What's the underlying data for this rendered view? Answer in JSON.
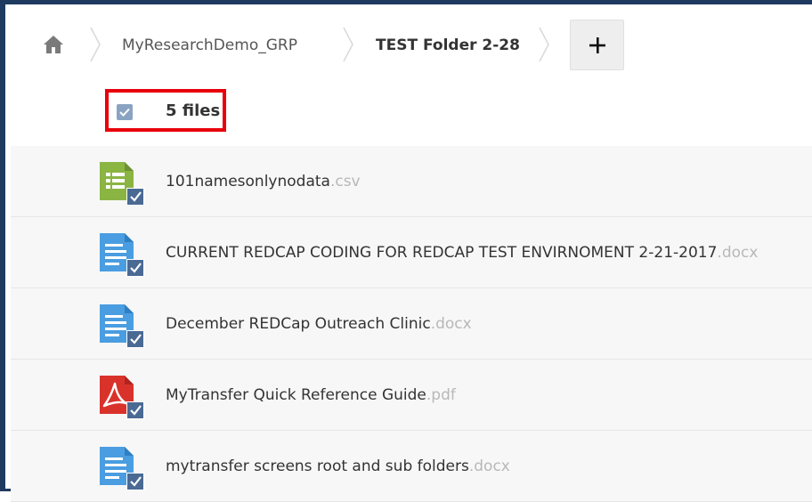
{
  "breadcrumb": {
    "items": [
      {
        "label": "MyResearchDemo_GRP"
      },
      {
        "label": "TEST Folder 2-28"
      }
    ],
    "add_label": "+"
  },
  "selection": {
    "checked": true,
    "label": "5 files",
    "highlight_color": "#e8000b"
  },
  "files": [
    {
      "name": "101namesonlynodata",
      "ext": ".csv",
      "type": "csv",
      "icon": "spreadsheet-icon",
      "icon_color": "#8ab543",
      "selected": true
    },
    {
      "name": "CURRENT REDCAP CODING FOR REDCAP TEST ENVIRNOMENT 2-21-2017",
      "ext": ".docx",
      "type": "docx",
      "icon": "document-icon",
      "icon_color": "#4a9de0",
      "selected": true
    },
    {
      "name": "December REDCap Outreach Clinic",
      "ext": ".docx",
      "type": "docx",
      "icon": "document-icon",
      "icon_color": "#4a9de0",
      "selected": true
    },
    {
      "name": "MyTransfer Quick Reference Guide",
      "ext": ".pdf",
      "type": "pdf",
      "icon": "pdf-icon",
      "icon_color": "#d9322b",
      "selected": true
    },
    {
      "name": "mytransfer screens root and sub folders",
      "ext": ".docx",
      "type": "docx",
      "icon": "document-icon",
      "icon_color": "#4a9de0",
      "selected": true
    }
  ],
  "colors": {
    "frame": "#1f3a5f",
    "checkbox": "#4a6a93",
    "extension_text": "#b8b8b8"
  }
}
